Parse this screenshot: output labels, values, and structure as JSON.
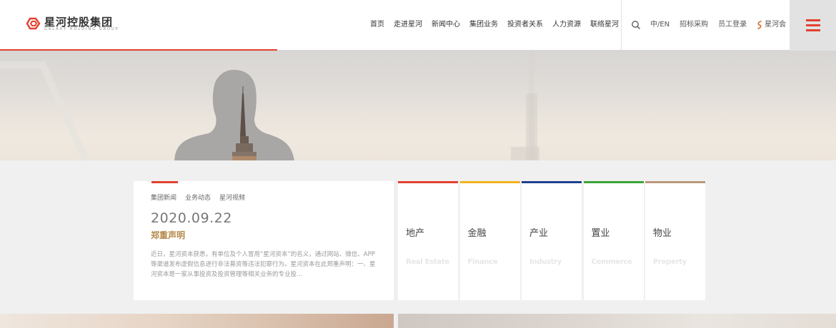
{
  "logo": {
    "name_cn": "星河控股集团",
    "name_en": "GALAXY HOLDING GROUP"
  },
  "nav": [
    "首页",
    "走进星河",
    "新闻中心",
    "集团业务",
    "投资者关系",
    "人力资源",
    "联络星河"
  ],
  "tools": {
    "language": "中/EN",
    "procurement": "招标采购",
    "staff_login": "员工登录",
    "star_club": "星河会"
  },
  "colors": {
    "accent_red": "#e2412f",
    "gold": "#b48a4a",
    "yellow": "#f2b31d",
    "blue": "#1f3f8f",
    "green": "#3aa436",
    "tan": "#b89a7c"
  },
  "news": {
    "tabs": [
      "集团新闻",
      "业务动态",
      "星河视频"
    ],
    "date": "2020.09.22",
    "title": "郑重声明",
    "excerpt": "近日，星河资本获悉，有单位及个人冒用“星河资本”的名义，通过网站、微信、APP等渠道发布虚假信息进行非法募资等违法犯罪行为。星河资本在此郑重声明：一、星河资本是一家从事投资及投资管理等相关业务的专业投..."
  },
  "business": [
    {
      "cn": "地产",
      "en": "Real Estate",
      "color": "#e2412f"
    },
    {
      "cn": "金融",
      "en": "Finance",
      "color": "#f2b31d"
    },
    {
      "cn": "产业",
      "en": "Industry",
      "color": "#1f3f8f"
    },
    {
      "cn": "置业",
      "en": "Commerce",
      "color": "#3aa436"
    },
    {
      "cn": "物业",
      "en": "Property",
      "color": "#b89a7c"
    }
  ]
}
